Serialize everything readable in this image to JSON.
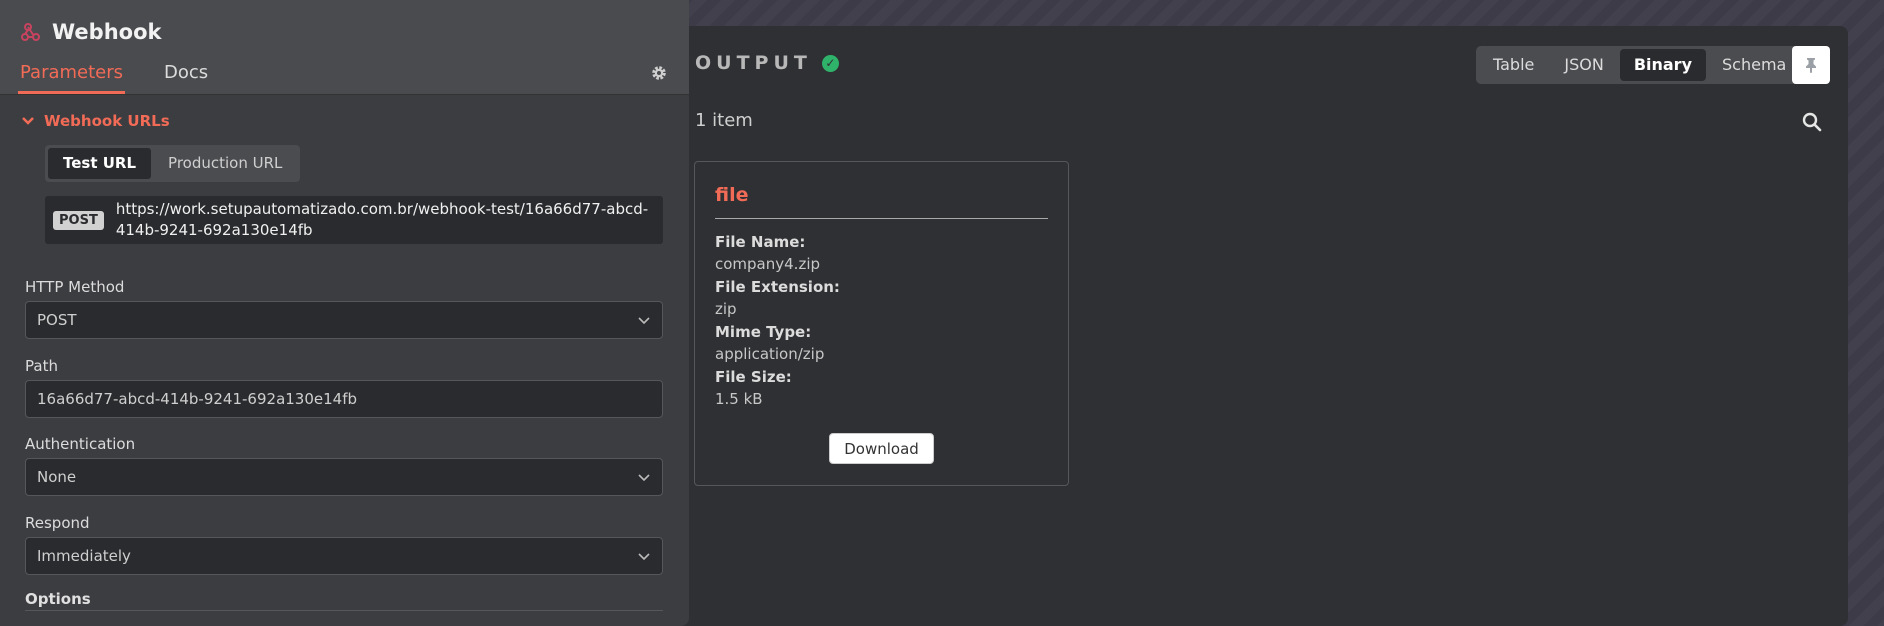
{
  "node": {
    "title": "Webhook",
    "tabs": [
      "Parameters",
      "Docs"
    ]
  },
  "webhook_urls": {
    "section_label": "Webhook URLs",
    "url_tabs": [
      "Test URL",
      "Production URL"
    ],
    "method": "POST",
    "url": "https://work.setupautomatizado.com.br/webhook-test/16a66d77-abcd-414b-9241-692a130e14fb"
  },
  "params": {
    "http_method": {
      "label": "HTTP Method",
      "value": "POST"
    },
    "path": {
      "label": "Path",
      "value": "16a66d77-abcd-414b-9241-692a130e14fb"
    },
    "authentication": {
      "label": "Authentication",
      "value": "None"
    },
    "respond": {
      "label": "Respond",
      "value": "Immediately"
    },
    "options_label": "Options"
  },
  "output": {
    "title": "OUTPUT",
    "view_tabs": [
      "Table",
      "JSON",
      "Binary",
      "Schema"
    ],
    "active_view": "Binary",
    "item_count": "1 item",
    "card": {
      "title": "file",
      "fields": [
        {
          "label": "File Name:",
          "value": "company4.zip"
        },
        {
          "label": "File Extension:",
          "value": "zip"
        },
        {
          "label": "Mime Type:",
          "value": "application/zip"
        },
        {
          "label": "File Size:",
          "value": "1.5 kB"
        }
      ],
      "download_label": "Download"
    }
  },
  "colors": {
    "accent": "#f26b57",
    "success": "#2fb36b"
  }
}
